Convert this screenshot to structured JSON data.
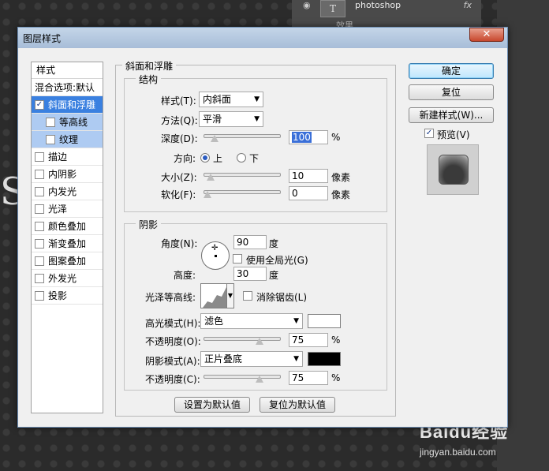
{
  "background": {
    "layer_name": "photoshop",
    "layer_fx": "fx",
    "layer_thumb": "T",
    "layer_sub": "效果",
    "left_glyph": "S"
  },
  "watermark": {
    "brand": "Baidu经验",
    "url": "jingyan.baidu.com"
  },
  "dialog": {
    "title": "图层样式",
    "close": "✕"
  },
  "sidebar": {
    "header": "样式",
    "items": [
      {
        "label": "混合选项:默认",
        "checkbox": false,
        "checked": false
      },
      {
        "label": "斜面和浮雕",
        "checkbox": true,
        "checked": true,
        "selected": true
      },
      {
        "label": "等高线",
        "checkbox": true,
        "checked": false,
        "sub": true
      },
      {
        "label": "纹理",
        "checkbox": true,
        "checked": false,
        "sub": true
      },
      {
        "label": "描边",
        "checkbox": true,
        "checked": false
      },
      {
        "label": "内阴影",
        "checkbox": true,
        "checked": false
      },
      {
        "label": "内发光",
        "checkbox": true,
        "checked": false
      },
      {
        "label": "光泽",
        "checkbox": true,
        "checked": false
      },
      {
        "label": "颜色叠加",
        "checkbox": true,
        "checked": false
      },
      {
        "label": "渐变叠加",
        "checkbox": true,
        "checked": false
      },
      {
        "label": "图案叠加",
        "checkbox": true,
        "checked": false
      },
      {
        "label": "外发光",
        "checkbox": true,
        "checked": false
      },
      {
        "label": "投影",
        "checkbox": true,
        "checked": false
      }
    ]
  },
  "bevel": {
    "group_title": "斜面和浮雕",
    "structure": {
      "title": "结构",
      "style_label": "样式(T):",
      "style_value": "内斜面",
      "method_label": "方法(Q):",
      "method_value": "平滑",
      "depth_label": "深度(D):",
      "depth_value": "100",
      "depth_unit": "%",
      "depth_level": 0.1,
      "direction_label": "方向:",
      "direction_up": "上",
      "direction_down": "下",
      "size_label": "大小(Z):",
      "size_value": "10",
      "size_unit": "像素",
      "size_level": 0.05,
      "soften_label": "软化(F):",
      "soften_value": "0",
      "soften_unit": "像素",
      "soften_level": 0
    },
    "shading": {
      "title": "阴影",
      "angle_label": "角度(N):",
      "angle_value": "90",
      "angle_unit": "度",
      "global_light_label": "使用全局光(G)",
      "altitude_label": "高度:",
      "altitude_value": "30",
      "altitude_unit": "度",
      "gloss_contour_label": "光泽等高线:",
      "anti_alias_label": "消除锯齿(L)",
      "highlight_mode_label": "高光模式(H):",
      "highlight_mode_value": "滤色",
      "highlight_color": "#ffffff",
      "highlight_opacity_label": "不透明度(O):",
      "highlight_opacity_value": "75",
      "highlight_opacity_unit": "%",
      "highlight_opacity_level": 0.75,
      "shadow_mode_label": "阴影模式(A):",
      "shadow_mode_value": "正片叠底",
      "shadow_color": "#000000",
      "shadow_opacity_label": "不透明度(C):",
      "shadow_opacity_value": "75",
      "shadow_opacity_unit": "%",
      "shadow_opacity_level": 0.75
    },
    "set_default": "设置为默认值",
    "reset_default": "复位为默认值"
  },
  "right": {
    "ok": "确定",
    "reset": "复位",
    "new_style": "新建样式(W)...",
    "preview_label": "预览(V)",
    "preview_checked": true
  }
}
